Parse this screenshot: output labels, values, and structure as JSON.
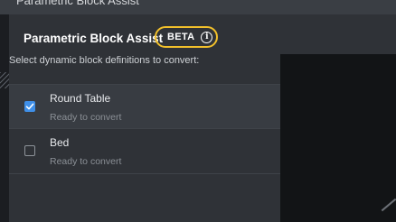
{
  "window": {
    "title": "Parametric Block Assist"
  },
  "header": {
    "title": "Parametric Block Assist",
    "badge": "BETA",
    "info_glyph": "i"
  },
  "instructions": "Select dynamic block definitions to convert:",
  "items": [
    {
      "name": "Round Table",
      "status": "Ready to convert",
      "checked": true
    },
    {
      "name": "Bed",
      "status": "Ready to convert",
      "checked": false
    }
  ],
  "colors": {
    "accent": "#3f8fe8",
    "badge_border": "#f2c02b",
    "panel": "#2f3237",
    "viewport": "#121416"
  },
  "icons": [
    "info-icon",
    "checkmark-icon"
  ]
}
